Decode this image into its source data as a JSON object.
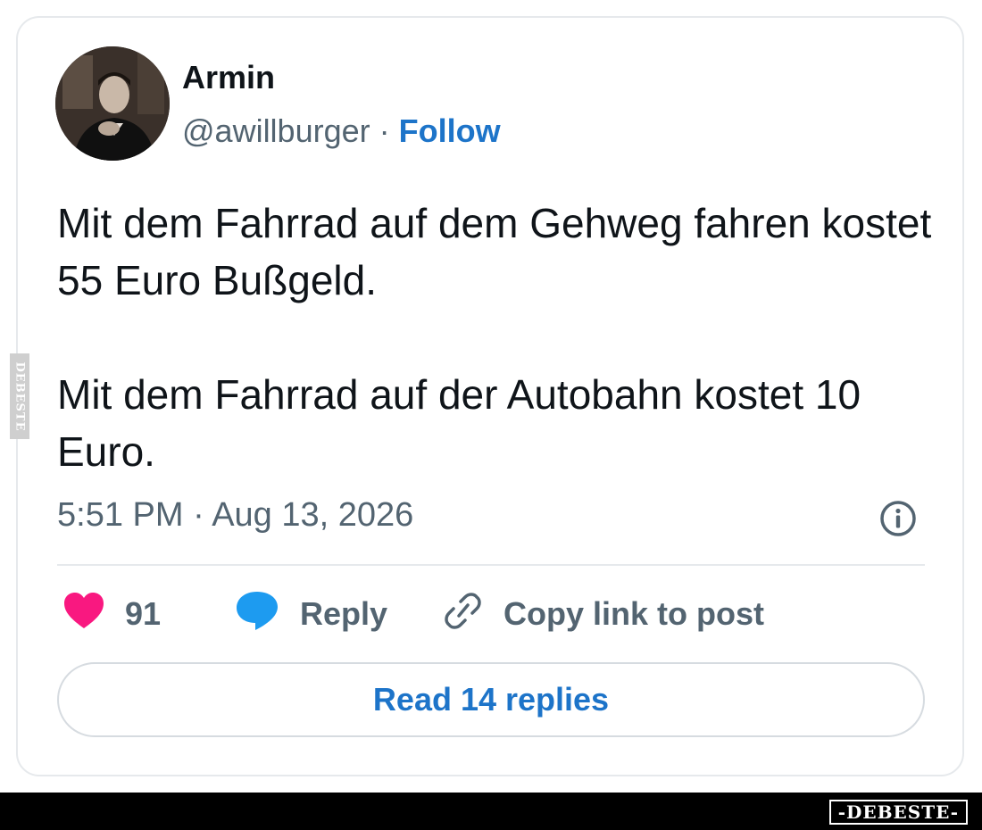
{
  "author": {
    "name": "Armin",
    "handle": "@awillburger",
    "separator": "·",
    "follow_label": "Follow"
  },
  "tweet": {
    "paragraphs": [
      "Mit dem Fahrrad auf dem Gehweg fahren kostet 55 Euro Bußgeld.",
      "Mit dem Fahrrad auf der Autobahn kostet 10 Euro."
    ],
    "timestamp": "5:51 PM · Aug 13, 2026"
  },
  "actions": {
    "like_count": "91",
    "reply_label": "Reply",
    "copy_link_label": "Copy link to post"
  },
  "read_replies_label": "Read 14 replies",
  "watermark": {
    "side": "DEBESTE",
    "footer": "-DEBESTE-"
  },
  "icons": {
    "avatar": "profile-photo",
    "info": "info-circle-icon",
    "like": "heart-icon",
    "reply": "speech-bubble-icon",
    "copy": "link-icon"
  },
  "colors": {
    "like": "#f91880",
    "reply": "#1d9bf0",
    "link": "#1d74c9",
    "muted": "#536471",
    "text": "#0f1419"
  }
}
